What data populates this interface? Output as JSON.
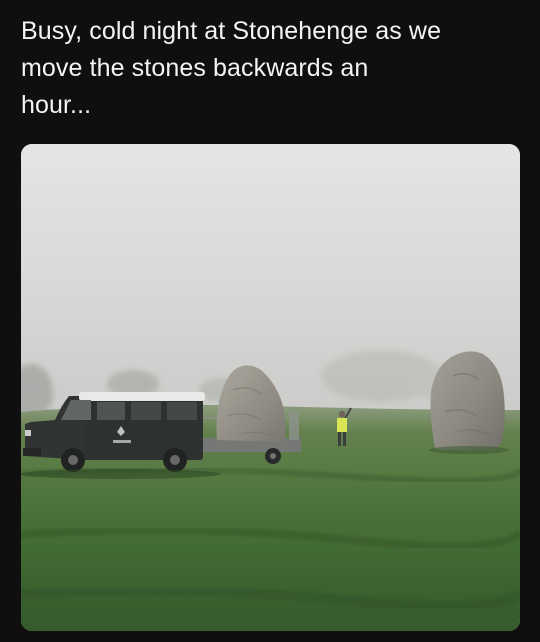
{
  "post": {
    "caption": "Busy, cold night at Stonehenge as we\nmove the stones backwards an\nhour..."
  },
  "photo": {
    "scene": [
      "fog-sky",
      "green-field",
      "standing-stone-right",
      "standing-stone-on-trailer",
      "land-rover",
      "trailer",
      "person-hi-vis-waving",
      "distant-trees"
    ]
  },
  "colors": {
    "background": "#0f0f0f",
    "text": "#f4f4f4",
    "fog": "#d8d8d6",
    "grass": "#3f6a2d",
    "vehicle": "#222725",
    "stone": "#8e8b84",
    "hi_vis": "#d9e64a"
  }
}
